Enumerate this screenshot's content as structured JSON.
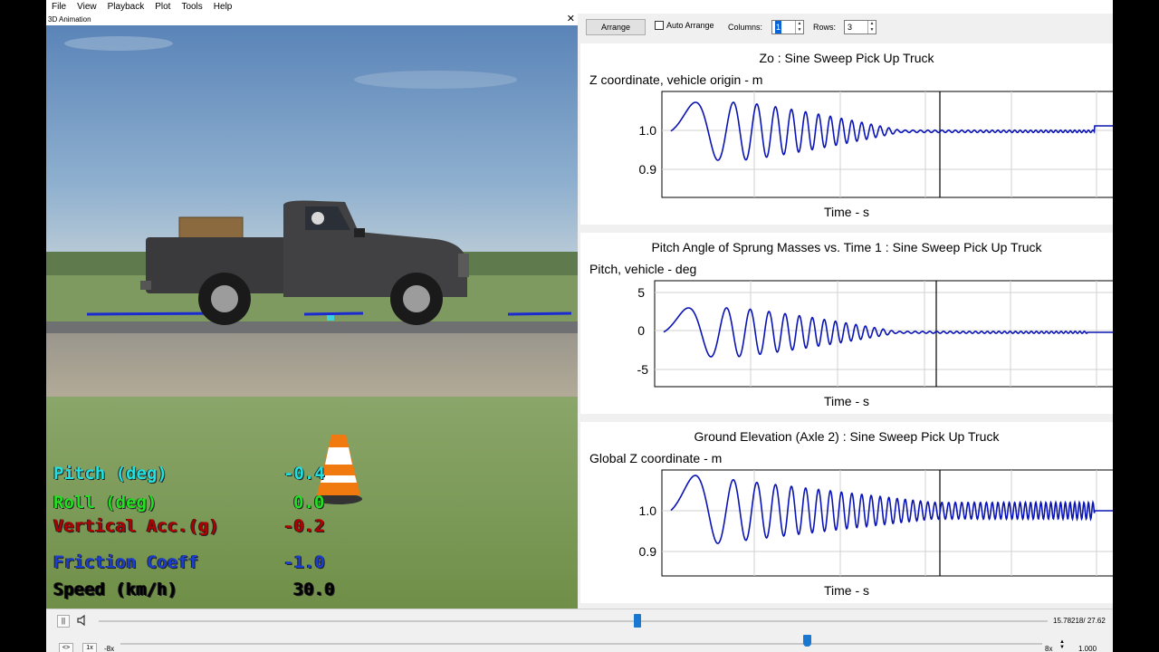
{
  "menu": [
    "File",
    "View",
    "Playback",
    "Plot",
    "Tools",
    "Help"
  ],
  "animation": {
    "window_title": "3D Animation",
    "close_glyph": "✕",
    "readouts": [
      {
        "label": "Pitch (deg)",
        "value": "-0.4",
        "color": "#22e0e0"
      },
      {
        "label": "Roll (deg)",
        "value": "0.0",
        "color": "#22e022"
      },
      {
        "label": "Vertical Acc.(g)",
        "value": "-0.2",
        "color": "#b00000"
      },
      {
        "label": "Friction Coeff",
        "value": "-1.0",
        "color": "#1a3fd0"
      },
      {
        "label": "Speed (km/h)",
        "value": "30.0",
        "color": "#000000"
      }
    ]
  },
  "toolbar": {
    "arrange_label": "Arrange",
    "auto_arrange_label": "Auto Arrange",
    "auto_arrange_checked": false,
    "columns_label": "Columns:",
    "columns_value": "1",
    "rows_label": "Rows:",
    "rows_value": "3"
  },
  "plots": [
    {
      "title": "Zo : Sine Sweep Pick Up Truck",
      "ylabel": "Z coordinate, vehicle origin - m",
      "xlabel": "Time - s",
      "yticks": [
        "1.0",
        "0.9"
      ]
    },
    {
      "title": "Pitch Angle of Sprung Masses vs. Time 1 : Sine Sweep Pick Up Truck",
      "ylabel": "Pitch, vehicle - deg",
      "xlabel": "Time - s",
      "yticks": [
        "5",
        "0",
        "-5"
      ]
    },
    {
      "title": "Ground Elevation (Axle 2) : Sine Sweep Pick Up Truck",
      "ylabel": "Global Z coordinate - m",
      "xlabel": "Time - s",
      "yticks": [
        "1.0",
        "0.9"
      ]
    }
  ],
  "plot_line_color": "#0a14b4",
  "playback": {
    "pause_glyph": "||",
    "time_readout": "15.78218/ 27.62",
    "time_fraction": 0.5714,
    "loop_label": "<>",
    "rate_label": "1x",
    "min_speed_label": "-8x",
    "max_speed_label": "8x",
    "speed_value": "1.000"
  }
}
